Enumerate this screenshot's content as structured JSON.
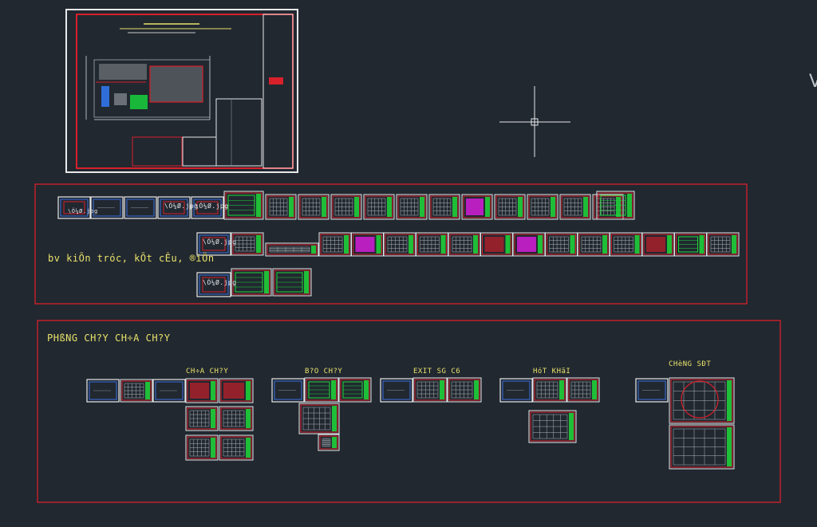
{
  "app": {
    "view": "model-space"
  },
  "colors": {
    "background": "#212830",
    "frame_red": "#d8202b",
    "sheet_white": "#e8e8ea",
    "sheet_blue": "#3b6fe0",
    "green": "#1fd83a",
    "magenta": "#e01ce3",
    "label_yellow": "#e9e26a"
  },
  "labels": {
    "group_architecture": "bv kiÕn tróc, kÕt cÊu, ®iÖn",
    "group_fire": "PHßNG CH?Y CH÷A CH?Y",
    "sub_chua_chay": "CH÷A CH?Y",
    "sub_bao_chay": "B?O CH?Y",
    "sub_exit": "EXIT SG C6",
    "sub_hut_khoi": "HóT KHãI",
    "sub_chong_set": "CHèNG SÐT",
    "missing_image": "\\Ó¼Ø.jpg",
    "edge_glyph": "V"
  },
  "cursor": {
    "icon": "crosshair-cursor-icon"
  }
}
